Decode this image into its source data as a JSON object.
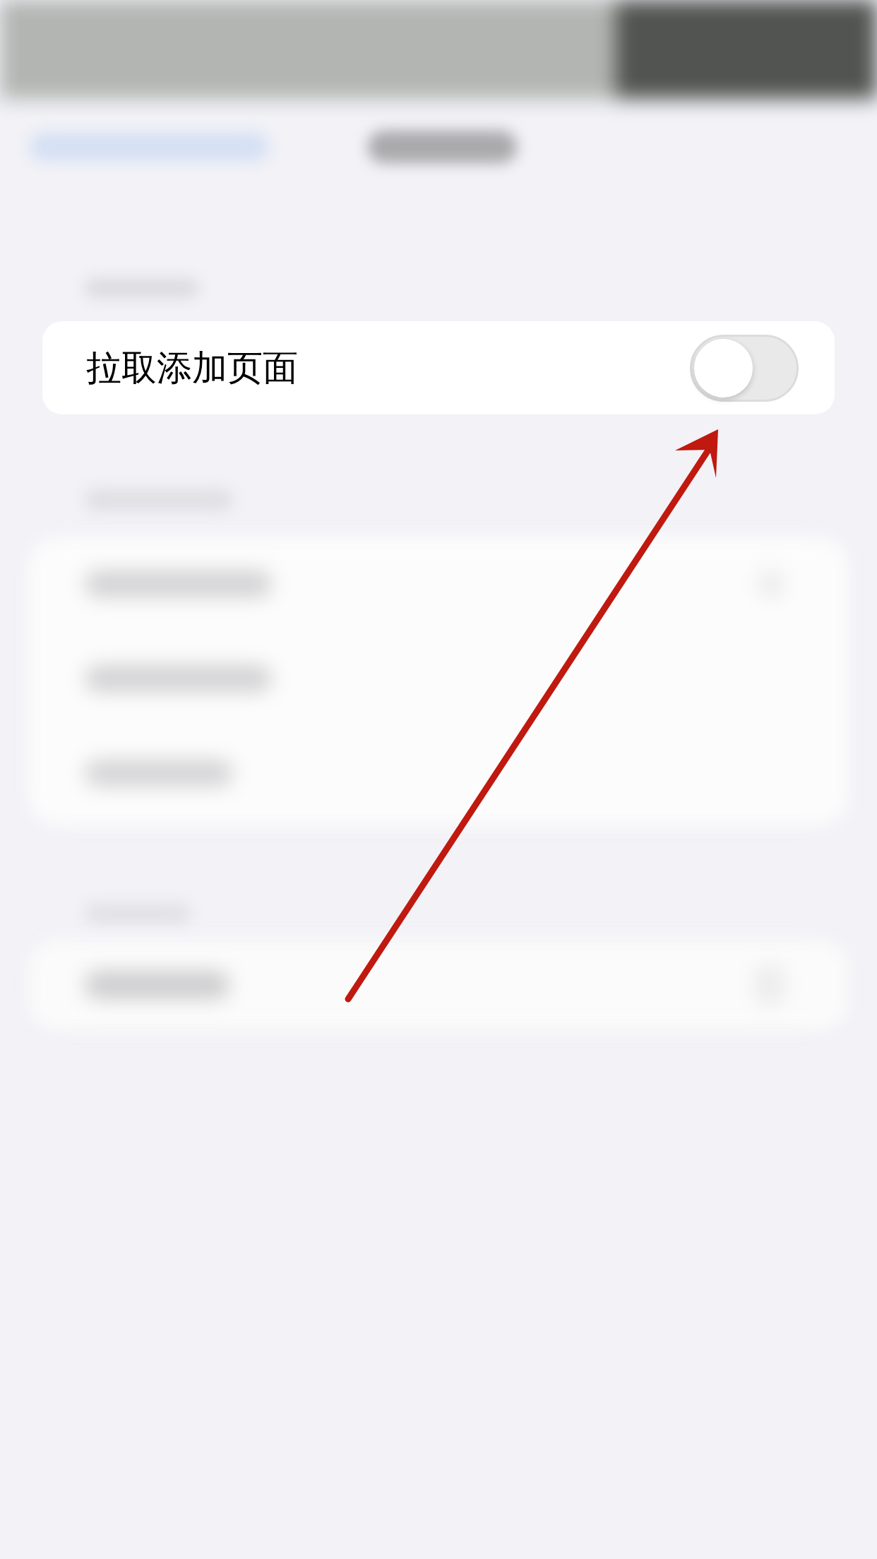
{
  "setting_row": {
    "label": "拉取添加页面",
    "on": false
  }
}
